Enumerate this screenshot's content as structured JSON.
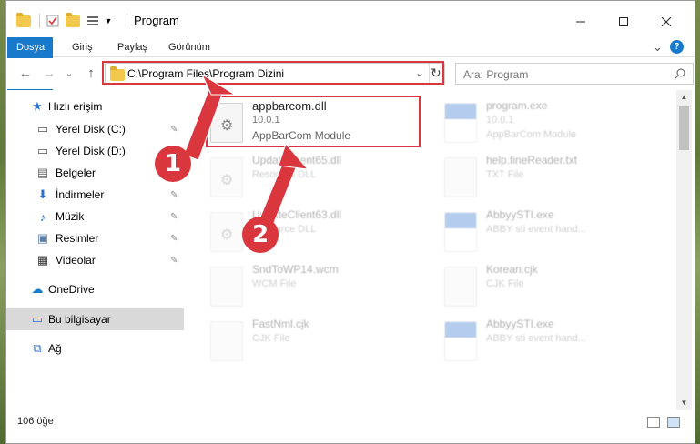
{
  "window": {
    "title": "Program"
  },
  "quick_access_icons": [
    "folder-icon",
    "properties-check-icon",
    "new-folder-icon",
    "view-menu-icon",
    "dropdown-caret-icon"
  ],
  "window_controls": [
    "minimize-icon",
    "maximize-icon",
    "close-icon"
  ],
  "ribbon": {
    "tabs": [
      "Dosya",
      "Giriş",
      "Paylaş",
      "Görünüm"
    ],
    "collapse_glyph": "⌄",
    "help_glyph": "?"
  },
  "nav": {
    "back_glyph": "←",
    "forward_glyph": "→",
    "recent_glyph": "⌄",
    "up_glyph": "↑",
    "address": "C:\\Program Files\\Program Dizini",
    "address_dropdown_glyph": "⌄",
    "refresh_glyph": "↻",
    "search_placeholder": "Ara: Program"
  },
  "sidebar": {
    "items": [
      {
        "label": "Hızlı erişim",
        "icon": "star-icon",
        "glyph": "★",
        "pinned": false
      },
      {
        "label": "Yerel Disk (C:)",
        "icon": "drive-icon",
        "glyph": "▭",
        "pinned": true
      },
      {
        "label": "Yerel Disk (D:)",
        "icon": "drive-icon",
        "glyph": "▭",
        "pinned": true
      },
      {
        "label": "Belgeler",
        "icon": "documents-icon",
        "glyph": "▤",
        "pinned": true
      },
      {
        "label": "İndirmeler",
        "icon": "download-icon",
        "glyph": "⬇",
        "pinned": true
      },
      {
        "label": "Müzik",
        "icon": "music-icon",
        "glyph": "♪",
        "pinned": true
      },
      {
        "label": "Resimler",
        "icon": "pictures-icon",
        "glyph": "▣",
        "pinned": true
      },
      {
        "label": "Videolar",
        "icon": "videos-icon",
        "glyph": "▦",
        "pinned": true
      },
      {
        "label": "OneDrive",
        "icon": "cloud-icon",
        "glyph": "☁",
        "pinned": false
      },
      {
        "label": "Bu bilgisayar",
        "icon": "computer-icon",
        "glyph": "▭",
        "pinned": false,
        "selected": true
      },
      {
        "label": "Ağ",
        "icon": "network-icon",
        "glyph": "⧉",
        "pinned": false
      }
    ],
    "pin_glyph": "📌"
  },
  "files": [
    {
      "name": "appbarcom.dll",
      "line1": "10.0.1",
      "line2": "AppBarCom Module",
      "icon": "dll-gear-icon"
    },
    {
      "name": "program.exe",
      "line1": "10.0.1",
      "line2": "AppBarCom Module",
      "icon": "exe-icon"
    },
    {
      "name": "UpdateClient65.dll",
      "line1": "Resource DLL",
      "line2": "",
      "icon": "dll-gear-icon"
    },
    {
      "name": "help.fineReader.txt",
      "line1": "TXT File",
      "line2": "",
      "icon": "text-file-icon"
    },
    {
      "name": "UpdateClient63.dll",
      "line1": "Resource DLL",
      "line2": "",
      "icon": "dll-gear-icon"
    },
    {
      "name": "AbbyySTI.exe",
      "line1": "ABBY sti event hand...",
      "line2": "",
      "icon": "exe-icon"
    },
    {
      "name": "SndToWP14.wcm",
      "line1": "WCM File",
      "line2": "",
      "icon": "blank-file-icon"
    },
    {
      "name": "Korean.cjk",
      "line1": "CJK File",
      "line2": "",
      "icon": "blank-file-icon"
    },
    {
      "name": "FastNml.cjk",
      "line1": "CJK File",
      "line2": "",
      "icon": "blank-file-icon"
    },
    {
      "name": "AbbyySTI.exe",
      "line1": "ABBY sti event hand...",
      "line2": "",
      "icon": "exe-icon"
    }
  ],
  "gear_glyph": "⚙",
  "scroll": {
    "up_glyph": "▲",
    "down_glyph": "▼"
  },
  "status": {
    "item_count": "106 öğe"
  },
  "annotations": {
    "marker_1": "1",
    "marker_2": "2",
    "color": "#d9363e"
  },
  "colors": {
    "accent": "#1979ca",
    "highlight": "#d9363e"
  }
}
